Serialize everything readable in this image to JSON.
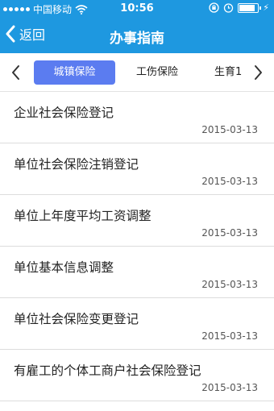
{
  "status_bar": {
    "carrier": "中国移动",
    "time": "10:56",
    "battery_level": 0.8
  },
  "nav": {
    "back_label": "返回",
    "title": "办事指南"
  },
  "tabs": [
    {
      "label": "城镇保险",
      "active": true
    },
    {
      "label": "工伤保险",
      "active": false
    },
    {
      "label": "生育1",
      "active": false
    }
  ],
  "items": [
    {
      "title": "企业社会保险登记",
      "date": "2015-03-13"
    },
    {
      "title": "单位社会保险注销登记",
      "date": "2015-03-13"
    },
    {
      "title": "单位上年度平均工资调整",
      "date": "2015-03-13"
    },
    {
      "title": "单位基本信息调整",
      "date": "2015-03-13"
    },
    {
      "title": "单位社会保险变更登记",
      "date": "2015-03-13"
    },
    {
      "title": "有雇工的个体工商户社会保险登记",
      "date": "2015-03-13"
    }
  ],
  "colors": {
    "header_bg": "#1e98e0",
    "active_tab": "#5b7cf0"
  },
  "icons": [
    "signal-icon",
    "wifi-icon",
    "lock-rotation-icon",
    "alarm-icon",
    "battery-icon",
    "charging-icon",
    "chevron-left-icon",
    "chevron-right-icon"
  ]
}
